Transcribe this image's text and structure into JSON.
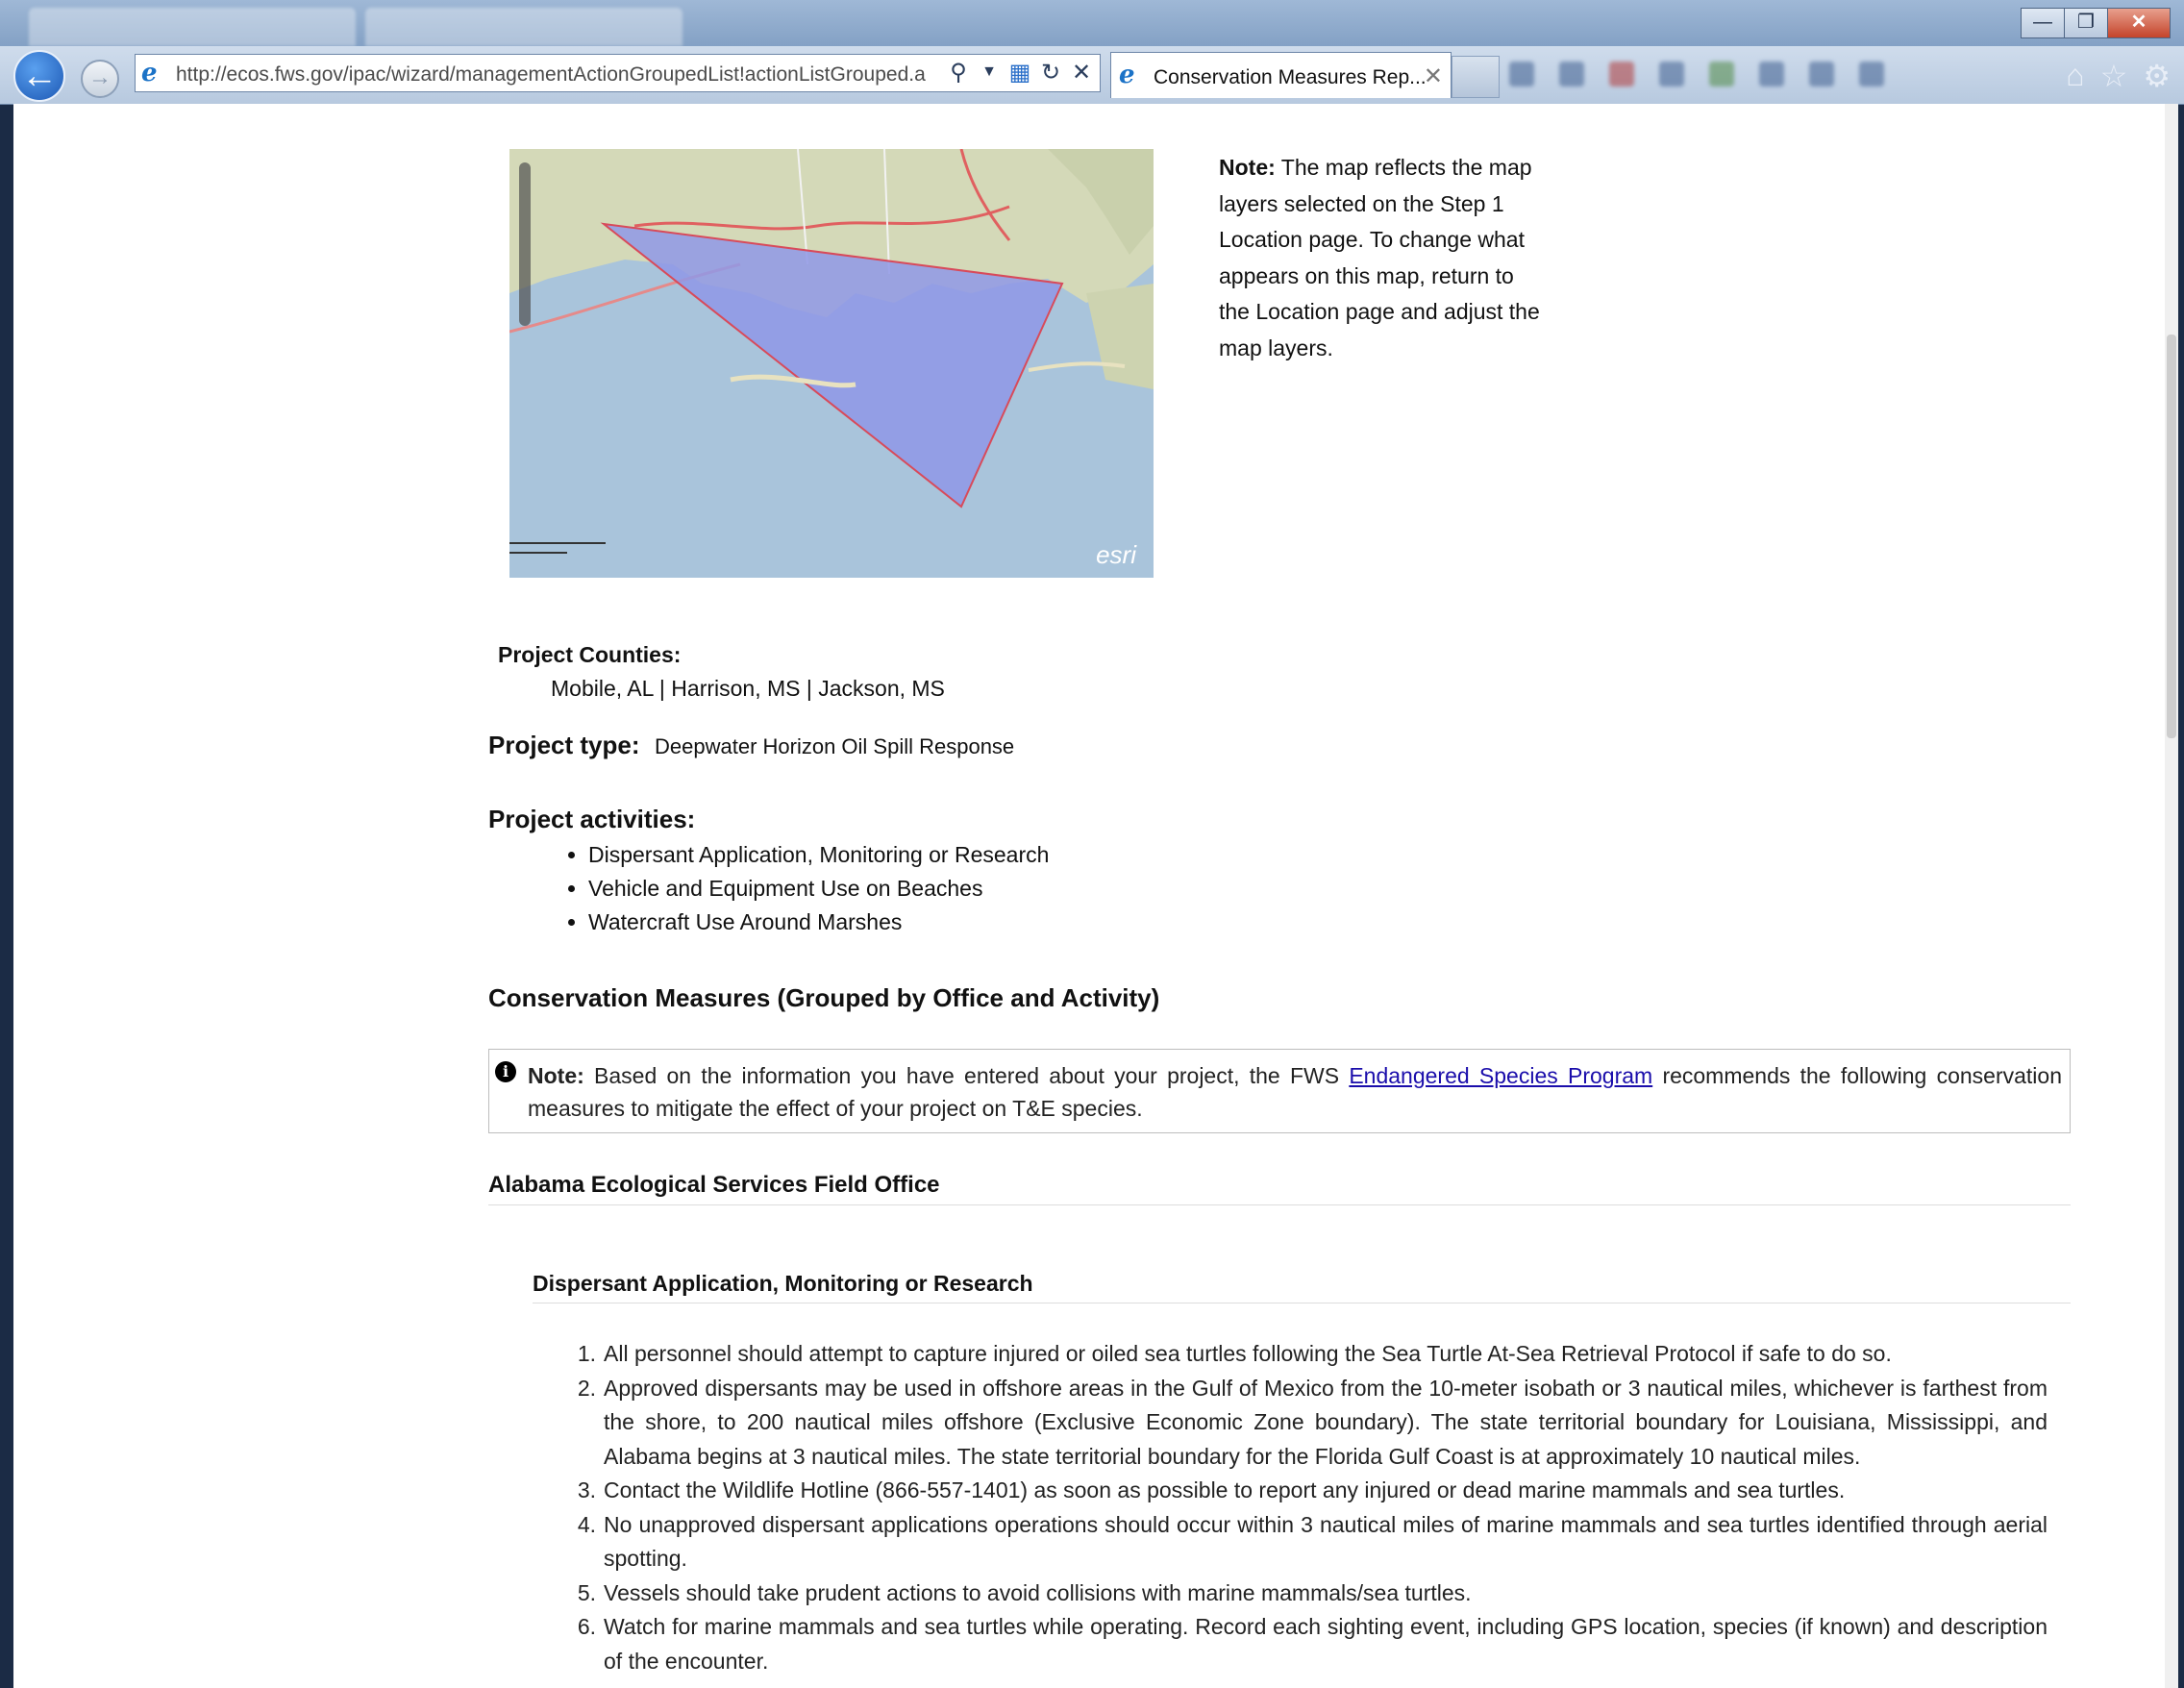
{
  "browser": {
    "url": "http://ecos.fws.gov/ipac/wizard/managementActionGroupedList!actionListGrouped.a",
    "tab_title": "Conservation Measures Rep...",
    "window_buttons": [
      "—",
      "❐",
      "✕"
    ]
  },
  "map": {
    "logo": "esri"
  },
  "map_note": {
    "label": "Note:",
    "text": "The map reflects the map layers selected on the Step 1 Location page. To change what appears on this map, return to the Location page and adjust the map layers."
  },
  "project": {
    "counties_label": "Project Counties:",
    "counties_value": "Mobile, AL | Harrison, MS | Jackson, MS",
    "type_label": "Project type:",
    "type_value": "Deepwater Horizon Oil Spill Response",
    "activities_label": "Project activities:",
    "activities": [
      "Dispersant Application, Monitoring or Research",
      "Vehicle and Equipment Use on Beaches",
      "Watercraft Use Around Marshes"
    ]
  },
  "conservation": {
    "title": "Conservation Measures (Grouped by Office and Activity)",
    "note_label": "Note:",
    "note_before": "Based on the information you have entered about your project, the FWS",
    "note_link": "Endangered Species Program",
    "note_after": "recommends the following conservation measures to mitigate the effect of your project on T&E species.",
    "office_title": "Alabama Ecological Services Field Office",
    "activity_title": "Dispersant Application, Monitoring or Research",
    "measures": [
      {
        "num": "1.",
        "text": "All personnel should attempt to capture injured or oiled sea turtles following the Sea Turtle At-Sea Retrieval Protocol if safe to do so."
      },
      {
        "num": "2.",
        "text": "Approved dispersants may be used in offshore areas in the Gulf of Mexico from the 10-meter isobath or 3 nautical miles, whichever is farthest from the shore, to 200 nautical miles offshore (Exclusive Economic Zone boundary). The state territorial boundary for Louisiana, Mississippi, and Alabama begins at 3 nautical miles. The state territorial boundary for the Florida Gulf Coast is at approximately 10 nautical miles."
      },
      {
        "num": "3.",
        "text": "Contact the Wildlife Hotline (866-557-1401) as soon as possible to report any injured or dead marine mammals and sea turtles."
      },
      {
        "num": "4.",
        "text": "No unapproved dispersant applications operations should occur within 3 nautical miles of marine mammals and sea turtles identified through aerial spotting."
      },
      {
        "num": "5.",
        "text": "Vessels should take prudent actions to avoid collisions with marine mammals/sea turtles."
      },
      {
        "num": "6.",
        "text": "Watch for marine mammals and sea turtles while operating. Record each sighting event, including GPS location, species (if known) and description of the encounter."
      }
    ]
  }
}
